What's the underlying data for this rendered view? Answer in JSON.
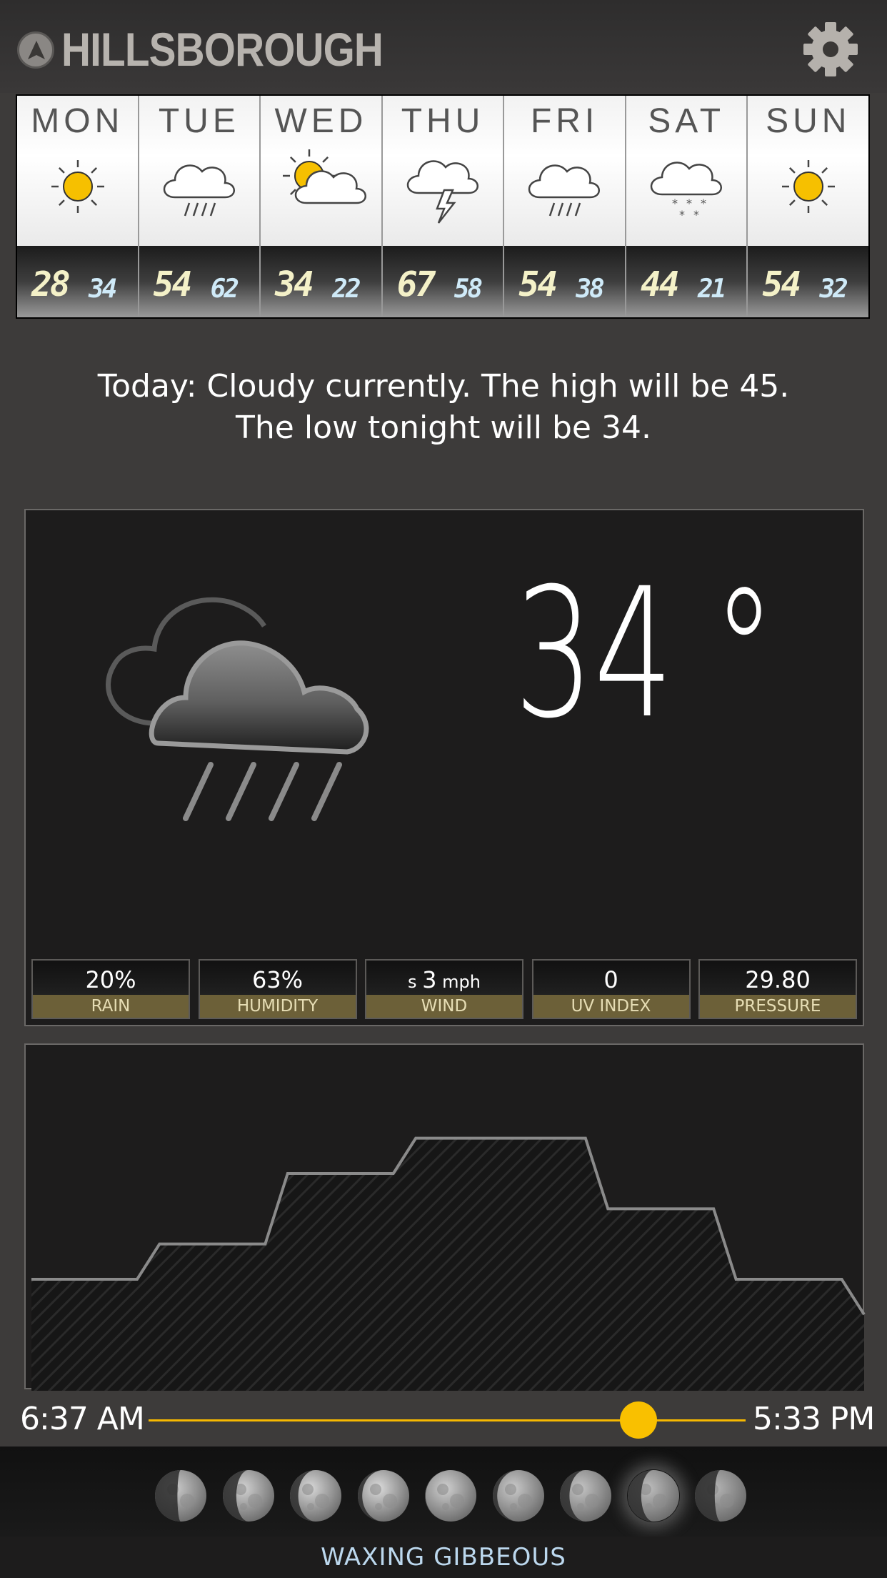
{
  "header": {
    "location_icon": "navigation-arrow-icon",
    "city": "HILLSBOROUGH",
    "settings_icon": "gear-icon"
  },
  "forecast": [
    {
      "day": "MON",
      "icon": "sun-icon",
      "high": "28",
      "low": "34"
    },
    {
      "day": "TUE",
      "icon": "rain-cloud-icon",
      "high": "54",
      "low": "62"
    },
    {
      "day": "WED",
      "icon": "partly-cloudy-icon",
      "high": "34",
      "low": "22"
    },
    {
      "day": "THU",
      "icon": "thunderstorm-icon",
      "high": "67",
      "low": "58"
    },
    {
      "day": "FRI",
      "icon": "rain-cloud-icon",
      "high": "54",
      "low": "38"
    },
    {
      "day": "SAT",
      "icon": "snow-cloud-icon",
      "high": "44",
      "low": "21"
    },
    {
      "day": "SUN",
      "icon": "sun-icon",
      "high": "54",
      "low": "32"
    }
  ],
  "summary": {
    "line1": "Today: Cloudy currently.  The high will be 45.",
    "line2": "The low tonight will be 34."
  },
  "current": {
    "icon": "cloudy-rain-icon",
    "temperature": "34",
    "degree": "°",
    "stats": [
      {
        "value_prefix": "",
        "value": "20%",
        "unit": "",
        "label": "RAIN"
      },
      {
        "value_prefix": "",
        "value": "63%",
        "unit": "",
        "label": "HUMIDITY"
      },
      {
        "value_prefix": "s ",
        "value": "3",
        "unit": " mph",
        "label": "WIND"
      },
      {
        "value_prefix": "",
        "value": "0",
        "unit": "",
        "label": "UV INDEX"
      },
      {
        "value_prefix": "",
        "value": "29.80",
        "unit": "",
        "label": "PRESSURE"
      }
    ]
  },
  "daylight": {
    "sunrise": "6:37 AM",
    "sunset": "5:33 PM",
    "progress": 0.82
  },
  "moon": {
    "phases_count": 9,
    "active_index": 7,
    "phase_name": "WAXING GIBBEOUS"
  },
  "colors": {
    "accent": "#f9c000",
    "label_bar": "#6c6038",
    "panel": "#1d1c1c",
    "background": "#3d3b3a"
  },
  "chart_data": {
    "type": "area",
    "series": [
      {
        "values": [
          3,
          3,
          4,
          4,
          6,
          6,
          7,
          7,
          7,
          5,
          5,
          3,
          3,
          2
        ]
      }
    ]
  }
}
